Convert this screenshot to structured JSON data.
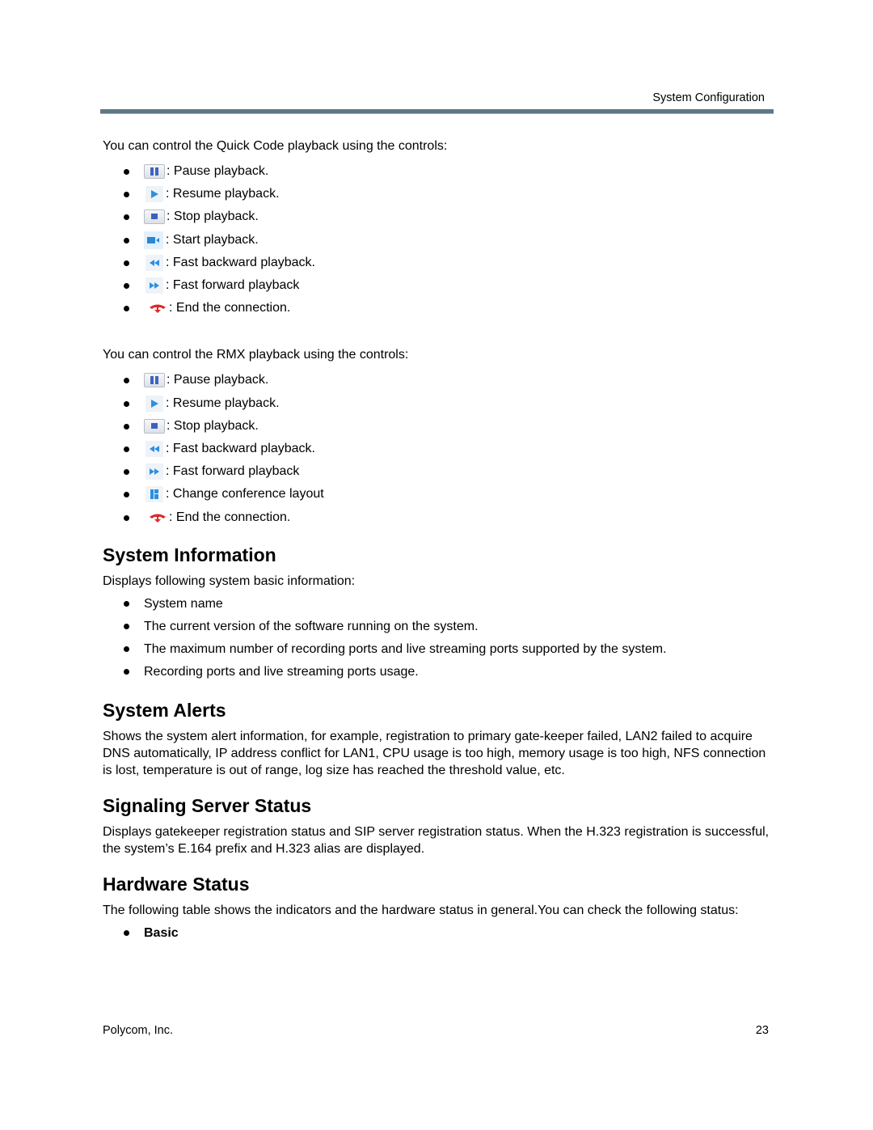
{
  "header": {
    "running_title": "System Configuration",
    "rule_color": "#5f7785"
  },
  "quick_code": {
    "intro": "You can control the Quick Code playback using the controls:",
    "controls": [
      {
        "icon": "pause-icon",
        "label": ": Pause playback."
      },
      {
        "icon": "play-icon",
        "label": ": Resume playback."
      },
      {
        "icon": "stop-icon",
        "label": ": Stop playback."
      },
      {
        "icon": "camera-icon",
        "label": ": Start playback."
      },
      {
        "icon": "rewind-icon",
        "label": ": Fast backward playback."
      },
      {
        "icon": "fast-forward-icon",
        "label": ": Fast forward playback"
      },
      {
        "icon": "hang-up-icon",
        "label": ": End the connection."
      }
    ]
  },
  "rmx": {
    "intro": "You can control the RMX playback using the controls:",
    "controls": [
      {
        "icon": "pause-icon",
        "label": ": Pause playback."
      },
      {
        "icon": "play-icon",
        "label": ": Resume playback."
      },
      {
        "icon": "stop-icon",
        "label": ": Stop playback."
      },
      {
        "icon": "rewind-icon",
        "label": ": Fast backward playback."
      },
      {
        "icon": "fast-forward-icon",
        "label": ": Fast forward playback"
      },
      {
        "icon": "layout-icon",
        "label": ": Change conference layout"
      },
      {
        "icon": "hang-up-icon",
        "label": ": End the connection."
      }
    ]
  },
  "system_information": {
    "heading": "System Information",
    "lead": "Displays following system basic information:",
    "items": [
      "System name",
      "The current version of the software running on the system.",
      "The maximum number of recording ports and live streaming ports supported by the system.",
      "Recording ports and live streaming ports usage."
    ]
  },
  "system_alerts": {
    "heading": "System Alerts",
    "body": "Shows the system alert information, for example, registration to primary gate-keeper failed, LAN2 failed to acquire DNS automatically, IP address conflict for LAN1, CPU usage is too high, memory usage is too high, NFS connection is lost, temperature is out of range, log size has reached the threshold value, etc."
  },
  "signaling_server_status": {
    "heading": "Signaling Server Status",
    "body": "Displays gatekeeper registration status and SIP server registration status. When the H.323 registration is successful, the system’s E.164 prefix and H.323 alias are displayed."
  },
  "hardware_status": {
    "heading": "Hardware Status",
    "body": "The following table shows the indicators and the hardware status in general.You can check the following status:",
    "items": [
      "Basic"
    ]
  },
  "footer": {
    "company": "Polycom, Inc.",
    "page_number": "23"
  }
}
